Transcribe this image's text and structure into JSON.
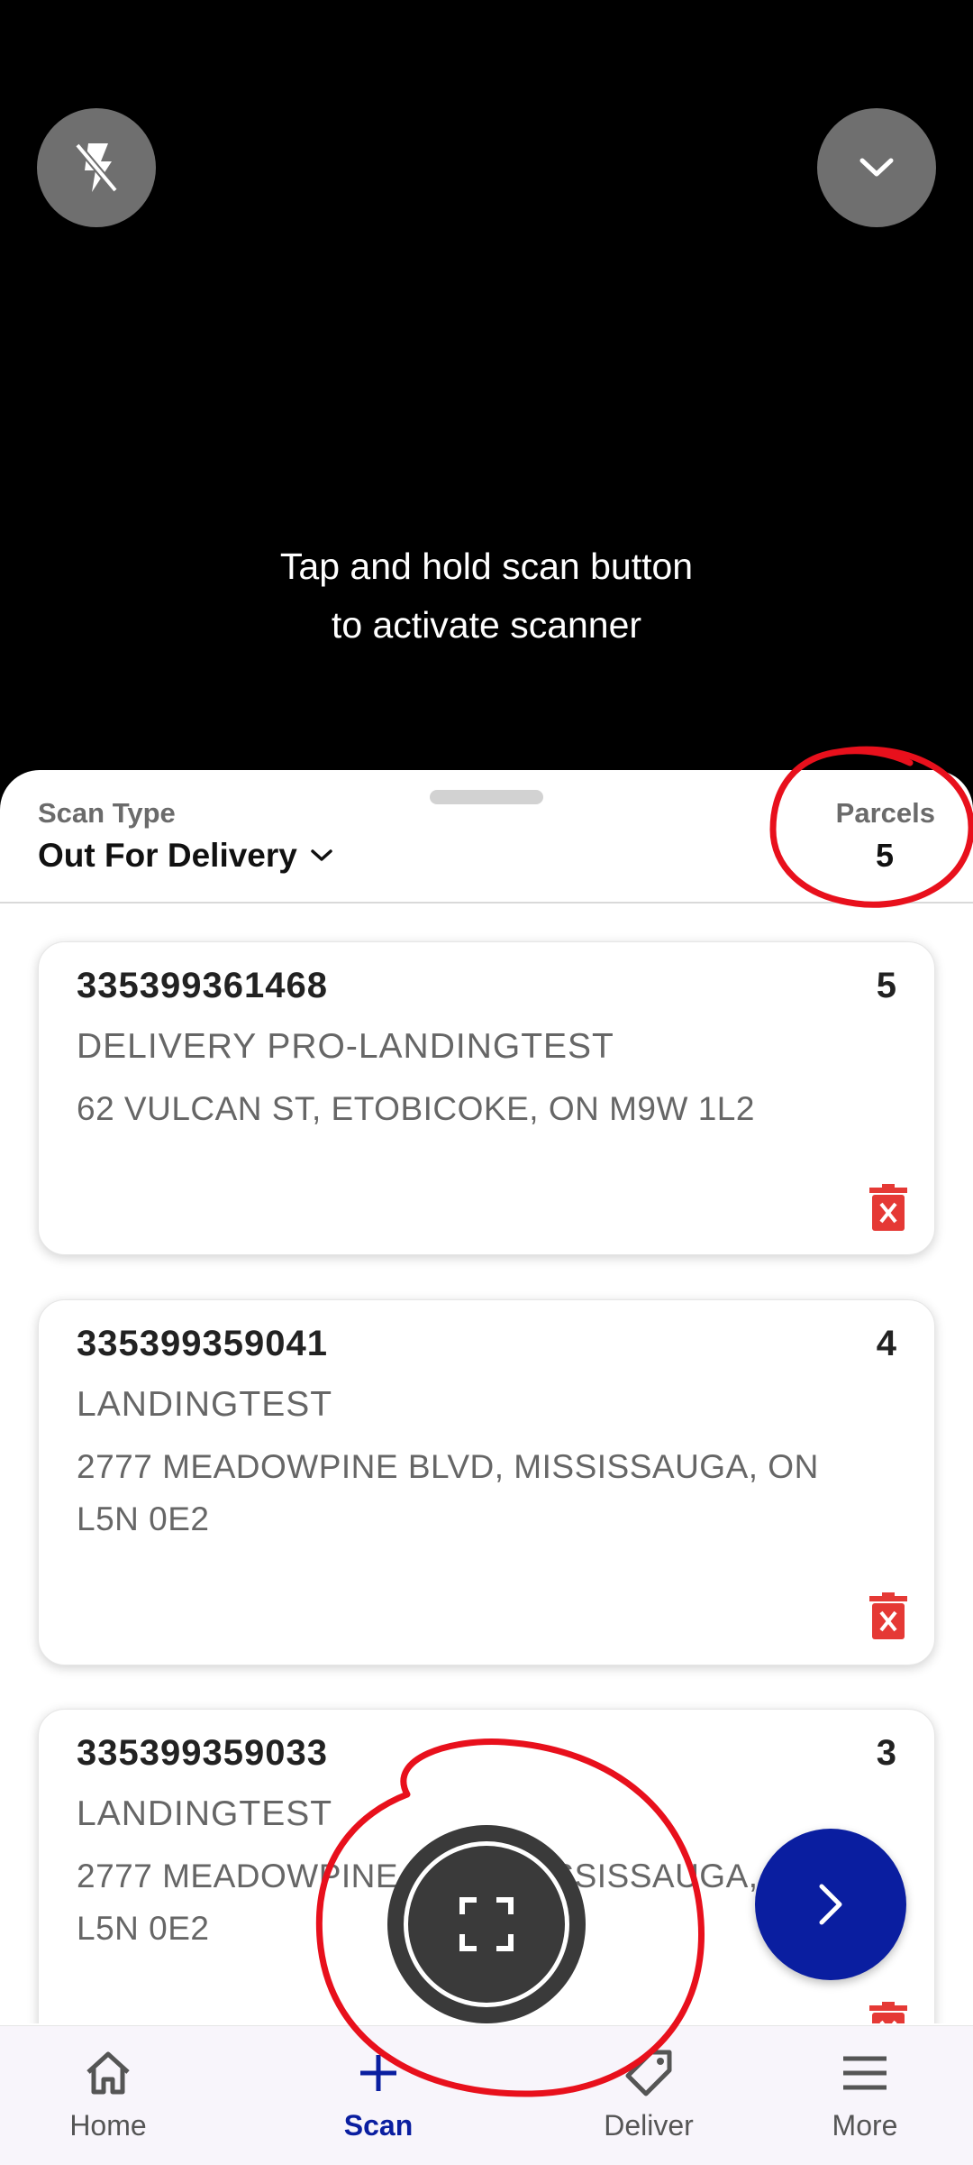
{
  "camera": {
    "flash_icon": "flash-off-icon",
    "collapse_icon": "chevron-down-icon",
    "hint_line1": "Tap and hold scan button",
    "hint_line2": "to activate scanner"
  },
  "sheet": {
    "scan_type_label": "Scan Type",
    "scan_type_value": "Out For Delivery",
    "parcels_label": "Parcels",
    "parcels_count": "5"
  },
  "parcels": [
    {
      "tracking": "335399361468",
      "count": "5",
      "name": "DELIVERY PRO-LANDINGTEST",
      "address": "62 VULCAN ST, ETOBICOKE, ON M9W 1L2"
    },
    {
      "tracking": "335399359041",
      "count": "4",
      "name": "LANDINGTEST",
      "address": "2777 MEADOWPINE BLVD, MISSISSAUGA, ON L5N 0E2"
    },
    {
      "tracking": "335399359033",
      "count": "3",
      "name": "LANDINGTEST",
      "address": "2777 MEADOWPINE BLVD, MISSISSAUGA, ON L5N 0E2"
    }
  ],
  "nav": {
    "items": [
      {
        "label": "Home",
        "icon": "home-icon"
      },
      {
        "label": "Scan",
        "icon": "plus-icon"
      },
      {
        "label": "Deliver",
        "icon": "tag-icon"
      },
      {
        "label": "More",
        "icon": "menu-icon"
      }
    ],
    "active": "Scan"
  },
  "colors": {
    "accent": "#0a1ea0",
    "delete": "#e53935",
    "annotation": "#e8101c"
  }
}
